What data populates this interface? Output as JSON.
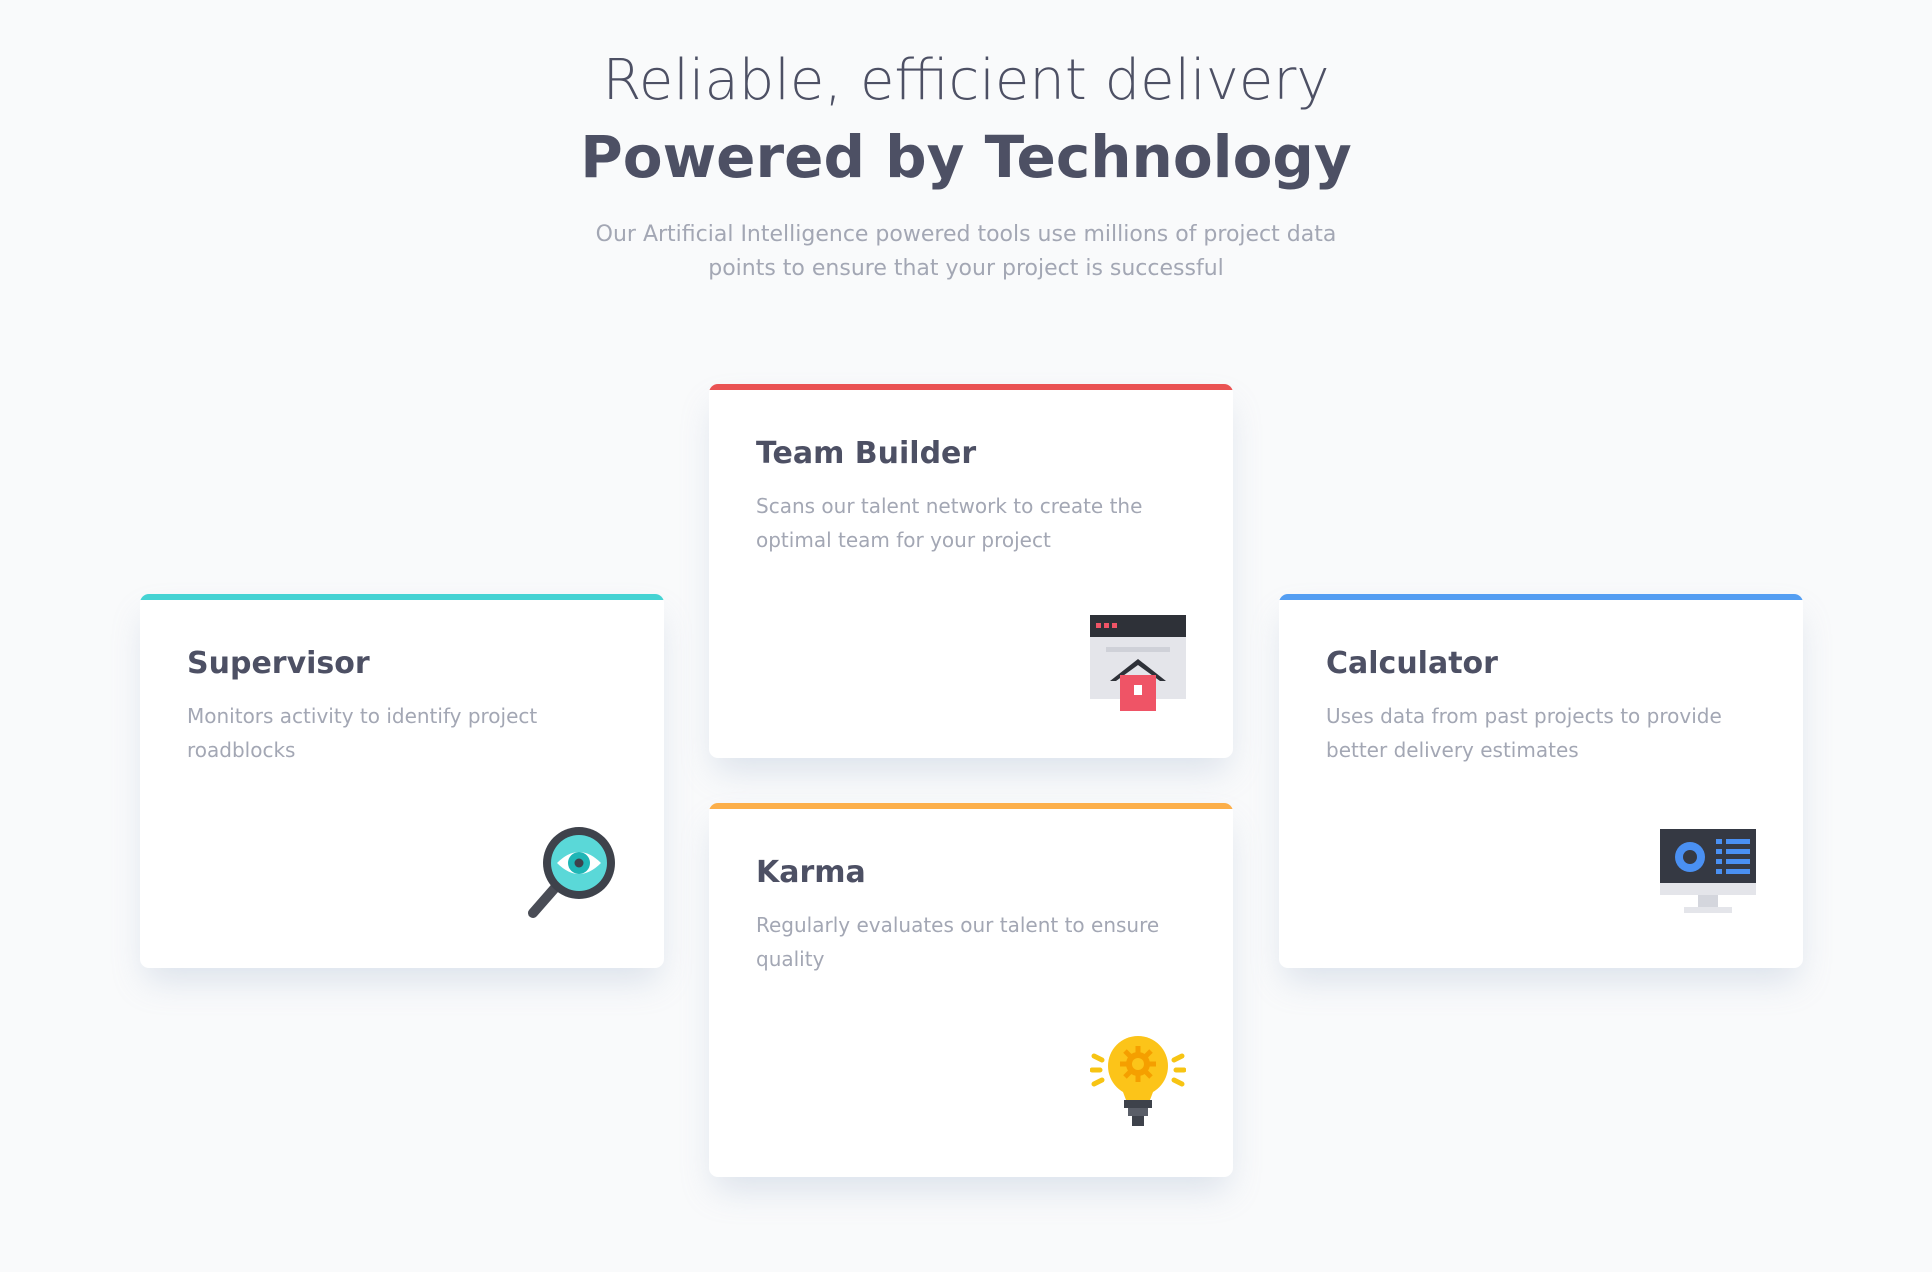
{
  "header": {
    "headline_light": "Reliable, efficient delivery",
    "headline_bold": "Powered by Technology",
    "intro": "Our Artificial Intelligence powered tools use millions of project data points to ensure that your project is successful"
  },
  "cards": [
    {
      "title": "Supervisor",
      "description": "Monitors activity to identify project roadblocks",
      "accent": "#45d3d3",
      "icon": "magnifier-eye-icon"
    },
    {
      "title": "Team Builder",
      "description": "Scans our talent network to create the optimal team for your project",
      "accent": "#ea5353",
      "icon": "browser-house-icon"
    },
    {
      "title": "Karma",
      "description": "Regularly evaluates our talent to ensure quality",
      "accent": "#fcaf4a",
      "icon": "lightbulb-icon"
    },
    {
      "title": "Calculator",
      "description": "Uses data from past projects to provide better delivery estimates",
      "accent": "#549ef2",
      "icon": "monitor-dashboard-icon"
    }
  ],
  "colors": {
    "background": "#f9fafb",
    "heading": "#4d5064",
    "body_text": "#a3a7b4"
  }
}
